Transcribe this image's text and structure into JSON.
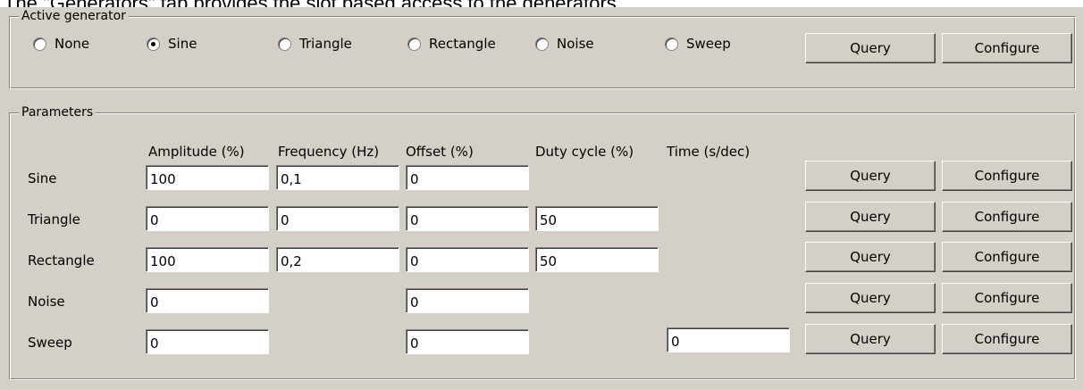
{
  "caption": "The \"Generators\" tab provides the slot based access to the generators.",
  "active_generator": {
    "title": "Active generator",
    "options": [
      {
        "label": "None",
        "selected": false
      },
      {
        "label": "Sine",
        "selected": true
      },
      {
        "label": "Triangle",
        "selected": false
      },
      {
        "label": "Rectangle",
        "selected": false
      },
      {
        "label": "Noise",
        "selected": false
      },
      {
        "label": "Sweep",
        "selected": false
      }
    ],
    "query_label": "Query",
    "configure_label": "Configure"
  },
  "parameters": {
    "title": "Parameters",
    "headers": {
      "amplitude": "Amplitude (%)",
      "frequency": "Frequency (Hz)",
      "offset": "Offset (%)",
      "duty_cycle": "Duty cycle (%)",
      "time": "Time (s/dec)"
    },
    "rows": [
      {
        "name": "Sine",
        "amplitude": "100",
        "frequency": "0,1",
        "offset": "0",
        "query_label": "Query",
        "configure_label": "Configure"
      },
      {
        "name": "Triangle",
        "amplitude": "0",
        "frequency": "0",
        "offset": "0",
        "duty_cycle": "50",
        "query_label": "Query",
        "configure_label": "Configure"
      },
      {
        "name": "Rectangle",
        "amplitude": "100",
        "frequency": "0,2",
        "offset": "0",
        "duty_cycle": "50",
        "query_label": "Query",
        "configure_label": "Configure"
      },
      {
        "name": "Noise",
        "amplitude": "0",
        "offset": "0",
        "query_label": "Query",
        "configure_label": "Configure"
      },
      {
        "name": "Sweep",
        "amplitude": "0",
        "offset": "0",
        "time": "0",
        "query_label": "Query",
        "configure_label": "Configure"
      }
    ]
  }
}
